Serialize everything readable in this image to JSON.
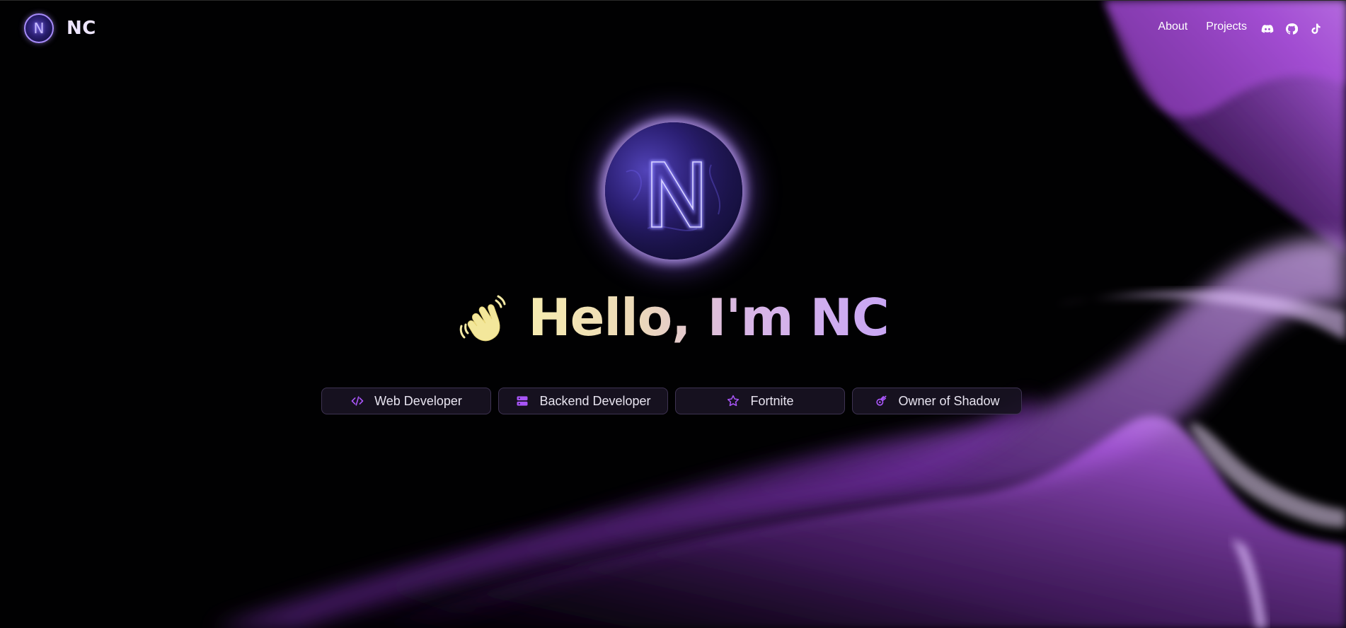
{
  "nav": {
    "brand_initial": "N",
    "brand_name": "NC",
    "links": [
      {
        "label": "About"
      },
      {
        "label": "Projects"
      }
    ],
    "socials": [
      {
        "icon": "discord-icon"
      },
      {
        "icon": "github-icon"
      },
      {
        "icon": "tiktok-icon"
      }
    ]
  },
  "hero": {
    "avatar_letter": "N",
    "wave_icon": "waving-hand-icon",
    "greeting": "Hello, I'm NC",
    "tags": [
      {
        "icon": "code-icon",
        "label": "Web Developer"
      },
      {
        "icon": "server-icon",
        "label": "Backend Developer"
      },
      {
        "icon": "star-icon",
        "label": "Fortnite"
      },
      {
        "icon": "comet-icon",
        "label": "Owner of Shadow"
      }
    ]
  },
  "colors": {
    "background": "#000000",
    "accent": "#a855f7",
    "pill_border": "#3e3352",
    "greeting_gradient_start": "#f6ecb0",
    "greeting_gradient_end": "#c8a6f4"
  }
}
